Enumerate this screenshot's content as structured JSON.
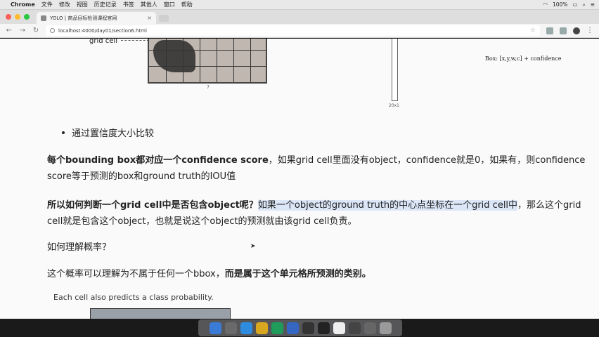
{
  "menubar": {
    "app": "Chrome",
    "items": [
      "文件",
      "修改",
      "视图",
      "历史记录",
      "书签",
      "其他人",
      "窗口",
      "帮助"
    ],
    "battery": "100%",
    "right_icons": [
      "wifi-icon",
      "battery-icon",
      "search-icon",
      "menu-list-icon"
    ]
  },
  "tab": {
    "title": "YOLO | 商品目标检测课程官网",
    "close": "×"
  },
  "address": {
    "url": "localhost:4000/day01/section6.html"
  },
  "figure": {
    "grid_cell_label": "grid cell",
    "grid_size_label": "7",
    "column_label": "20x1",
    "box_formula": "Box: [x,y,w,c] + confidence"
  },
  "content": {
    "bullet": "通过置信度大小比较",
    "p1": {
      "bold": "每个bounding box都对应一个confidence score",
      "rest": "，如果grid cell里面没有object，confidence就是0，如果有，则confidence score等于预测的box和ground truth的IOU值"
    },
    "p2": {
      "bold": "所以如何判断一个grid cell中是否包含object呢？",
      "highlight": "如果一个object的ground truth的中心点坐标在一个grid cell中",
      "rest": "，那么这个grid cell就是包含这个object，也就是说这个object的预测就由该grid cell负责。"
    },
    "p3": "如何理解概率？",
    "p4": {
      "plain": "这个概率可以理解为不属于任何一个bbox，",
      "bold": "而是属于这个单元格所预测的类别。"
    },
    "caption": "Each cell also predicts a class probability."
  },
  "dock": {
    "apps": [
      {
        "name": "finder-icon",
        "color": "#3b7bd8"
      },
      {
        "name": "launchpad-icon",
        "color": "#6a6a6a"
      },
      {
        "name": "safari-icon",
        "color": "#2d8be0"
      },
      {
        "name": "chrome-icon",
        "color": "#d9a61f"
      },
      {
        "name": "pycharm-icon",
        "color": "#1f9c5a"
      },
      {
        "name": "keynote-icon",
        "color": "#3466c2"
      },
      {
        "name": "quicktime-icon",
        "color": "#333333"
      },
      {
        "name": "terminal-icon",
        "color": "#222222"
      },
      {
        "name": "typora-icon",
        "color": "#eeeeee"
      },
      {
        "name": "music-icon",
        "color": "#444444"
      },
      {
        "name": "screenshot-icon",
        "color": "#666666"
      },
      {
        "name": "trash-icon",
        "color": "#9a9a9a"
      }
    ]
  }
}
